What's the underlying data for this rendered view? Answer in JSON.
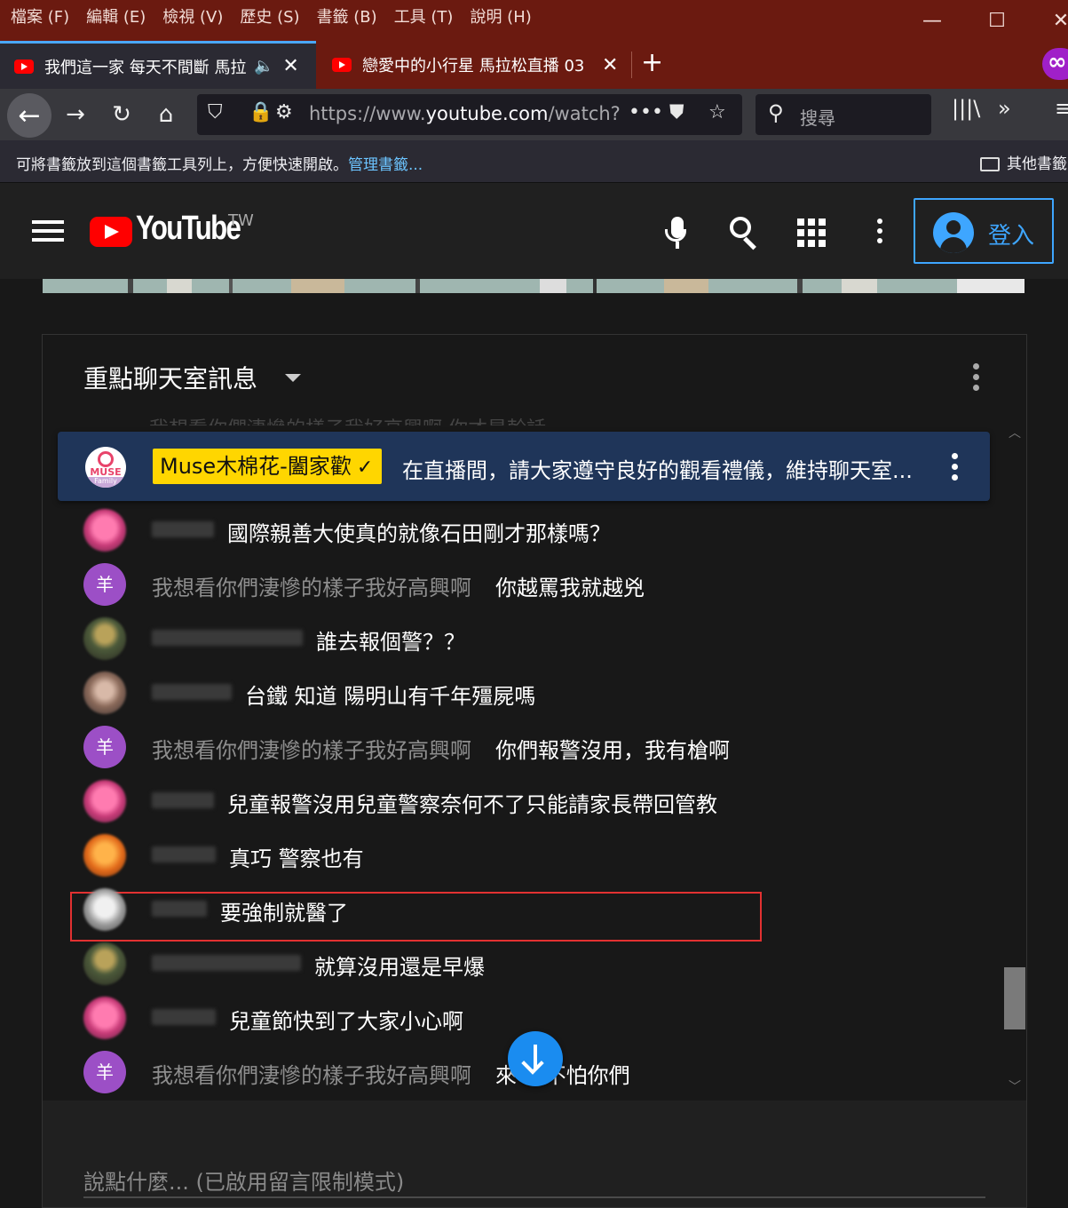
{
  "menubar": {
    "items": [
      "檔案 (F)",
      "編輯 (E)",
      "檢視 (V)",
      "歷史 (S)",
      "書籤 (B)",
      "工具 (T)",
      "說明 (H)"
    ],
    "minimize": "—",
    "maximize": "☐",
    "close": "✕"
  },
  "tabs": [
    {
      "title": "我們這一家 每天不間斷 馬拉",
      "audio_icon": "🔈",
      "close": "✕"
    },
    {
      "title": "戀愛中的小行星 馬拉松直播 03",
      "close": "✕"
    }
  ],
  "new_tab": "+",
  "navbar": {
    "url_prefix": "https://www.",
    "url_host": "youtube.com",
    "url_path": "/watch?",
    "page_actions": "•••",
    "search_placeholder": "搜尋",
    "library_icon": "|||\\",
    "overflow": "»",
    "menu": "≡"
  },
  "bookmarks": {
    "hint": "可將書籤放到這個書籤工具列上，方便快速開啟。",
    "manage_link": "管理書籤...",
    "other": "其他書籤"
  },
  "youtube": {
    "wordmark": "YouTube",
    "region": "TW",
    "signin_label": "登入"
  },
  "chat": {
    "title": "重點聊天室訊息",
    "ghost_text": "我想看你們淒慘的樣子我好高興啊 你才是幹話",
    "pinned": {
      "logo_text": "MUSE",
      "logo_sub": "Family",
      "author": "Muse木棉花-闔家歡",
      "verified": "✓",
      "message": "在直播間，請大家遵守良好的觀看禮儀，維持聊天室..."
    },
    "messages": [
      {
        "author": "",
        "text": "國際親善大使真的就像石田剛才那樣嗎？",
        "avatar": "pink"
      },
      {
        "author": "我想看你們淒慘的樣子我好高興啊",
        "text": "你越罵我就越兇",
        "avatar": "purple",
        "avatar_char": "羊"
      },
      {
        "author": "",
        "text": "誰去報個警？？",
        "avatar": "camo"
      },
      {
        "author": "",
        "text": "台鐵 知道 陽明山有千年殭屍嗎",
        "avatar": "photo"
      },
      {
        "author": "我想看你們淒慘的樣子我好高興啊",
        "text": "你們報警沒用，我有槍啊",
        "avatar": "purple",
        "avatar_char": "羊"
      },
      {
        "author": "",
        "text": "兒童報警沒用兒童警察奈何不了只能請家長帶回管教",
        "avatar": "pink"
      },
      {
        "author": "",
        "text": "真巧 警察也有",
        "avatar": "orange"
      },
      {
        "author": "",
        "text": "要強制就醫了",
        "avatar": "grey"
      },
      {
        "author": "",
        "text": "就算沒用還是早爆",
        "avatar": "camo"
      },
      {
        "author": "",
        "text": "兒童節快到了大家小心啊",
        "avatar": "pink"
      },
      {
        "author": "我想看你們淒慘的樣子我好高興啊",
        "text": "來 我不怕你們",
        "avatar": "purple",
        "avatar_char": "羊"
      }
    ],
    "input_placeholder": "說點什麼... (已啟用留言限制模式)"
  },
  "colors": {
    "firefox_frame": "#6b1a10",
    "youtube_red": "#ff0000",
    "accent_blue": "#3ea6ff",
    "pinned_bg": "#1f3559",
    "owner_badge": "#ffd600",
    "highlight_box": "#e23131",
    "user_avatar": "#9c4fc6"
  }
}
